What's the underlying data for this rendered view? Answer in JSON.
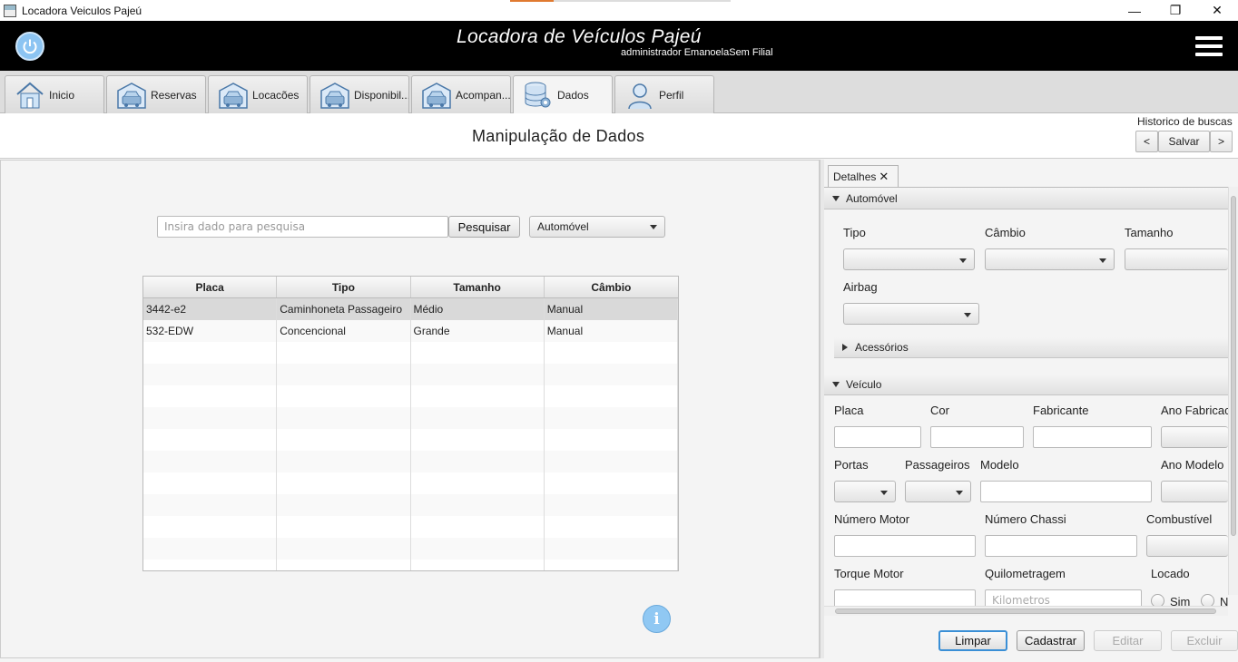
{
  "window": {
    "title": "Locadora Veiculos Pajeú",
    "minimize": "—",
    "maximize": "❐",
    "close": "✕"
  },
  "header": {
    "title": "Locadora de Veículos Pajeú",
    "user": "administrador EmanoelaSem Filial"
  },
  "tabs": [
    {
      "label": "Inicio",
      "icon": "house-icon"
    },
    {
      "label": "Reservas",
      "icon": "garage-car-icon"
    },
    {
      "label": "Locacões",
      "icon": "garage-car-icon"
    },
    {
      "label": "Disponibil...",
      "icon": "garage-car-icon"
    },
    {
      "label": "Acompan...",
      "icon": "garage-car-icon"
    },
    {
      "label": "Dados",
      "icon": "database-gear-icon",
      "active": true
    },
    {
      "label": "Perfil",
      "icon": "user-icon"
    }
  ],
  "page": {
    "title": "Manipulação de Dados",
    "history_label": "Historico de buscas",
    "prev": "<",
    "save": "Salvar",
    "next": ">"
  },
  "search": {
    "placeholder": "Insira dado para pesquisa",
    "button": "Pesquisar",
    "category": "Automóvel"
  },
  "table": {
    "columns": [
      "Placa",
      "Tipo",
      "Tamanho",
      "Câmbio"
    ],
    "rows": [
      [
        "3442-e2",
        "Caminhoneta Passageiro",
        "Médio",
        "Manual"
      ],
      [
        "532-EDW",
        "Concencional",
        "Grande",
        "Manual"
      ]
    ],
    "selected_row": 0
  },
  "details": {
    "tab_label": "Detalhes",
    "tab_close": "✕",
    "automovel": {
      "title": "Automóvel",
      "tipo": "Tipo",
      "cambio": "Câmbio",
      "tamanho": "Tamanho",
      "airbag": "Airbag",
      "acessorios": "Acessórios"
    },
    "veiculo": {
      "title": "Veículo",
      "placa": "Placa",
      "cor": "Cor",
      "fabricante": "Fabricante",
      "ano_fabricacao": "Ano Fabricac",
      "portas": "Portas",
      "passageiros": "Passageiros",
      "modelo": "Modelo",
      "ano_modelo": "Ano Modelo",
      "numero_motor": "Número Motor",
      "numero_chassi": "Número Chassi",
      "combustivel": "Combustível",
      "torque_motor": "Torque Motor",
      "quilometragem": "Quilometragem",
      "quilometragem_placeholder": "Kilometros",
      "locado": "Locado",
      "sim": "Sim",
      "nao": "N"
    }
  },
  "actions": {
    "limpar": "Limpar",
    "cadastrar": "Cadastrar",
    "editar": "Editar",
    "excluir": "Excluir"
  },
  "colors": {
    "header_bg": "#000000",
    "accent_blue": "#90c8f3",
    "focus": "#3a8fd6"
  }
}
